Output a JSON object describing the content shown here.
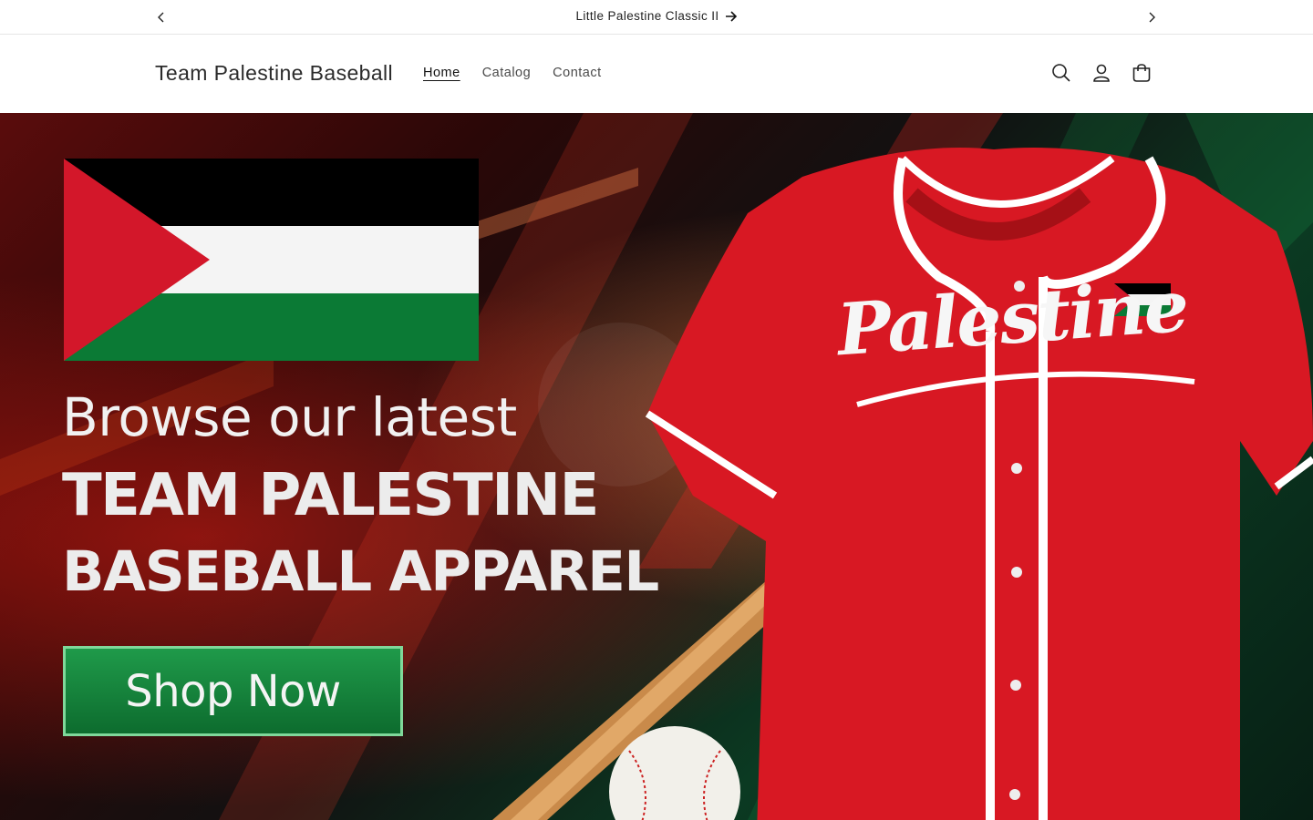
{
  "announcement": {
    "text": "Little Palestine Classic II"
  },
  "header": {
    "brand": "Team Palestine Baseball",
    "nav": [
      {
        "label": "Home",
        "active": true
      },
      {
        "label": "Catalog",
        "active": false
      },
      {
        "label": "Contact",
        "active": false
      }
    ],
    "icons": [
      "search-icon",
      "account-icon",
      "cart-icon"
    ]
  },
  "hero": {
    "line1": "Browse our latest",
    "line2": "TEAM PALESTINE",
    "line3": "BASEBALL APPAREL",
    "cta": "Shop Now",
    "jersey_text": "Palestine",
    "colors": {
      "flag_black": "#000000",
      "flag_white": "#ffffff",
      "flag_green": "#0b7a35",
      "flag_red": "#d3172a",
      "jersey_red": "#d81823",
      "button_green": "#168a3e"
    }
  }
}
